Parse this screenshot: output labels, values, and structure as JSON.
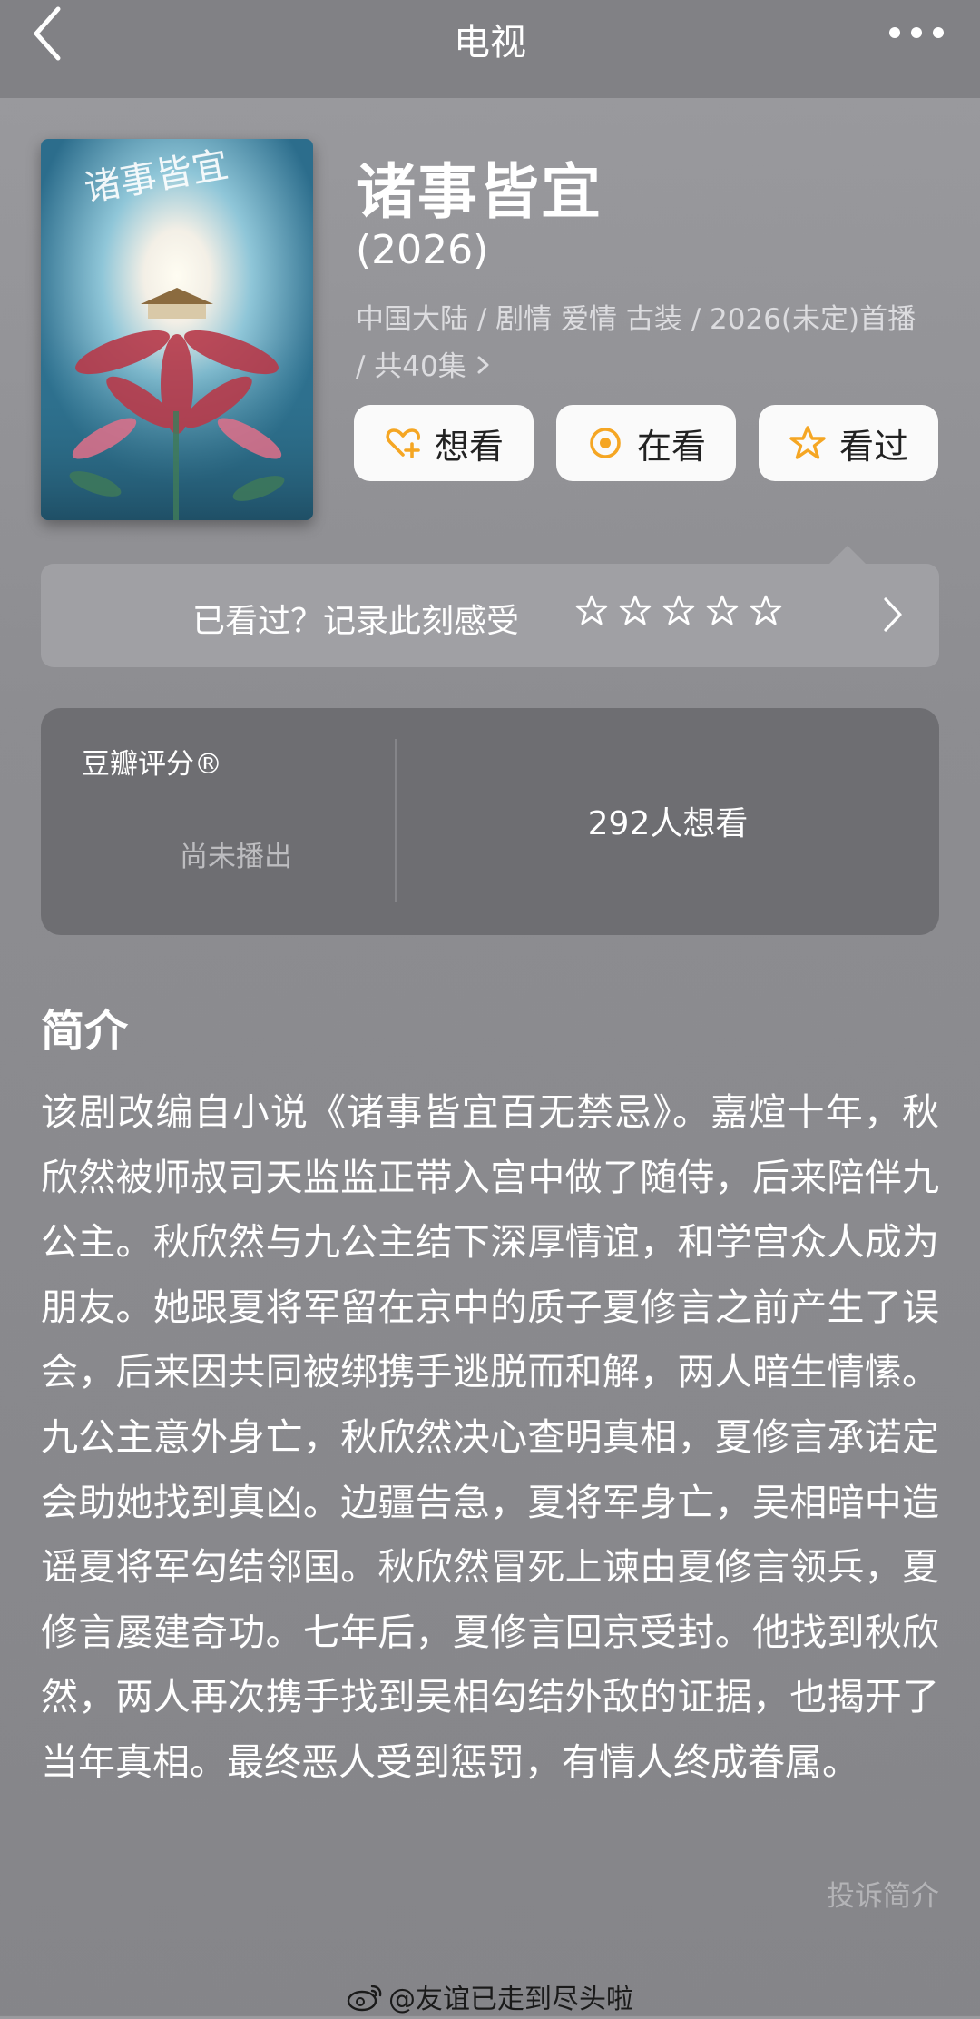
{
  "header": {
    "title": "电视"
  },
  "show": {
    "title": "诸事皆宜",
    "year": "(2026)",
    "meta": "中国大陆 / 剧情 爱情 古装 / 2026(未定)首播 / 共40集"
  },
  "actions": {
    "want": "想看",
    "watching": "在看",
    "watched": "看过",
    "accent_color": "#f5a623"
  },
  "record": {
    "prompt": "已看过？记录此刻感受",
    "stars_total": 5,
    "stars_filled": 0
  },
  "rating": {
    "label": "豆瓣评分®",
    "status": "尚未播出",
    "want_count": "292人想看"
  },
  "synopsis": {
    "heading": "简介",
    "text": "该剧改编自小说《诸事皆宜百无禁忌》。嘉煊十年，秋欣然被师叔司天监监正带入宫中做了随侍，后来陪伴九公主。秋欣然与九公主结下深厚情谊，和学宫众人成为朋友。她跟夏将军留在京中的质子夏修言之前产生了误会，后来因共同被绑携手逃脱而和解，两人暗生情愫。九公主意外身亡，秋欣然决心查明真相，夏修言承诺定会助她找到真凶。边疆告急，夏将军身亡，吴相暗中造谣夏将军勾结邻国。秋欣然冒死上谏由夏修言领兵，夏修言屡建奇功。七年后，夏修言回京受封。他找到秋欣然，两人再次携手找到吴相勾结外敌的证据，也揭开了当年真相。最终恶人受到惩罚，有情人终成眷属。",
    "report": "投诉简介"
  },
  "watermark": {
    "text": "@友谊已走到尽头啦"
  }
}
